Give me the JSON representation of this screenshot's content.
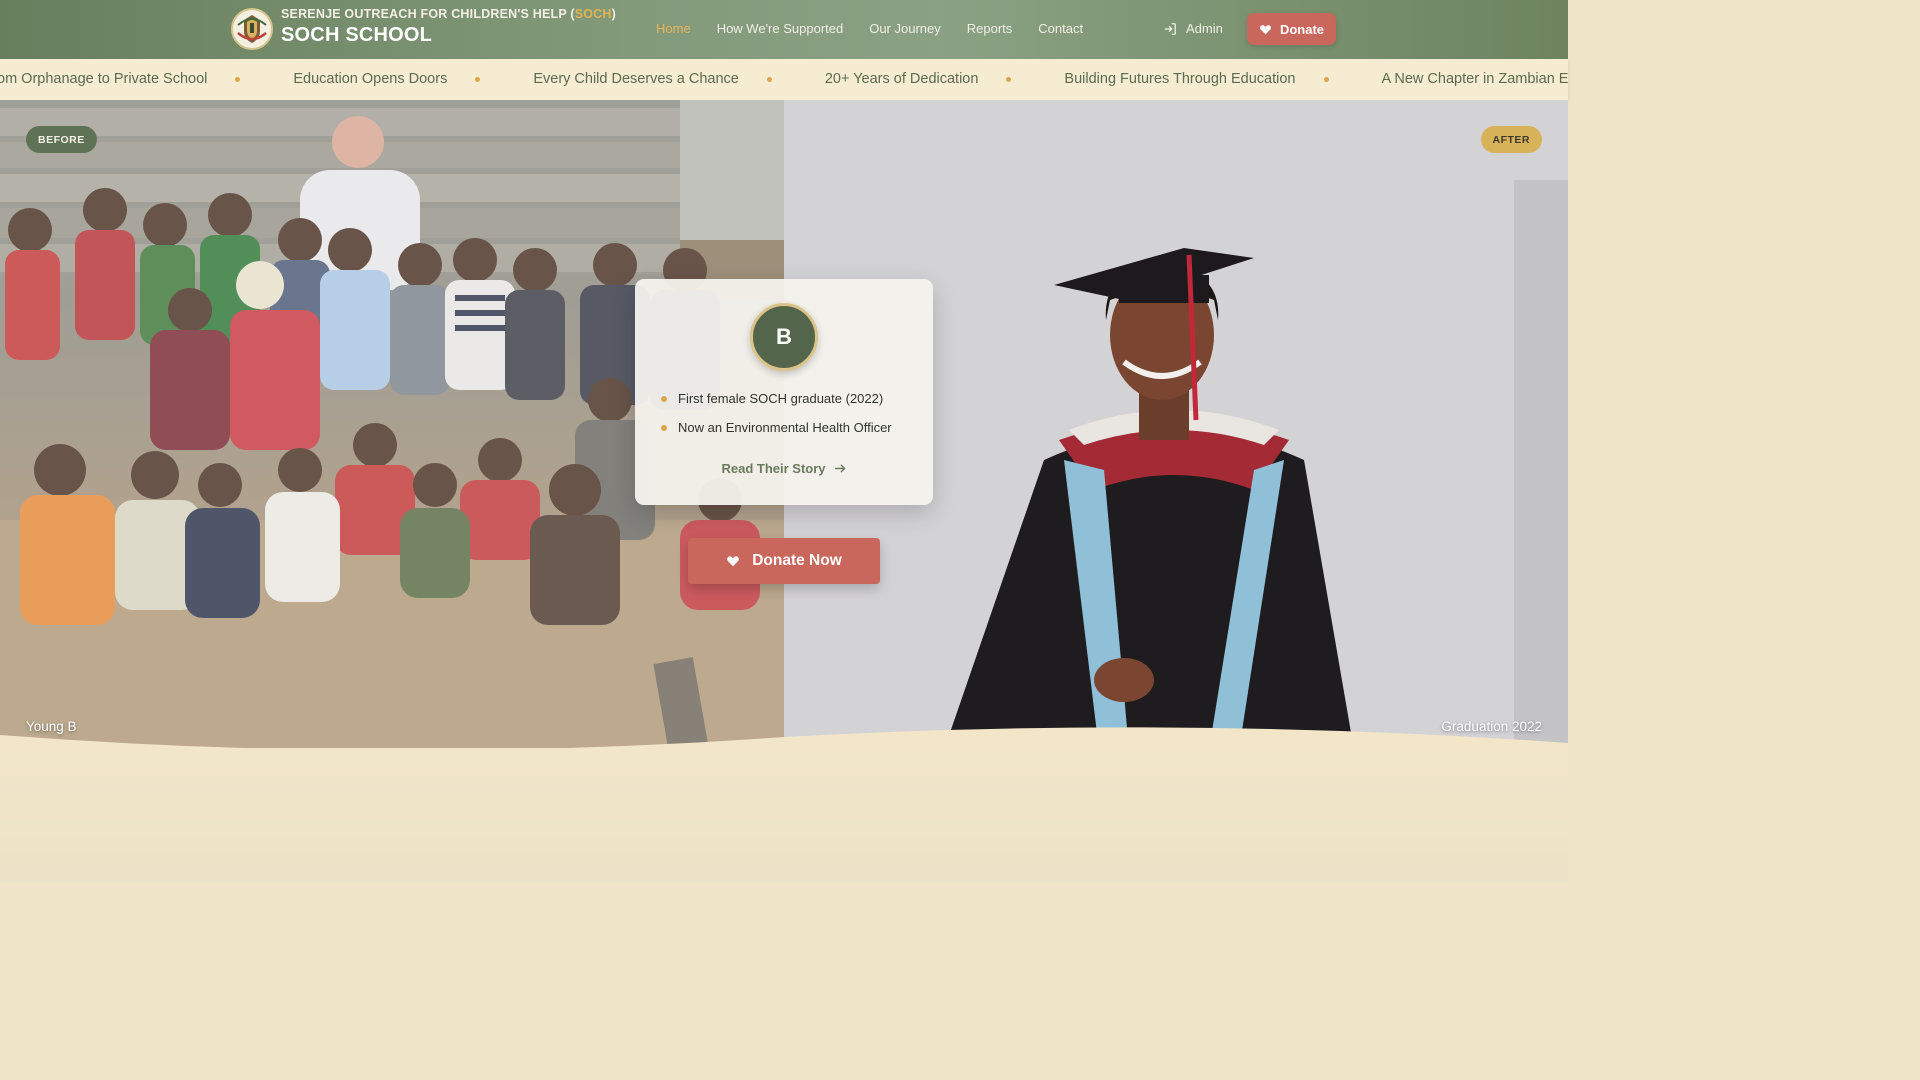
{
  "header": {
    "org_prefix": "SERENJE OUTREACH FOR CHILDREN'S HELP (",
    "org_accent": "SOCH",
    "org_suffix": ")",
    "title": "SOCH SCHOOL",
    "nav": [
      {
        "label": "Home",
        "active": true
      },
      {
        "label": "How We're Supported",
        "active": false
      },
      {
        "label": "Our Journey",
        "active": false
      },
      {
        "label": "Reports",
        "active": false
      },
      {
        "label": "Contact",
        "active": false
      }
    ],
    "admin_label": "Admin",
    "donate_label": "Donate"
  },
  "ticker": {
    "items": [
      "om Orphanage to Private School",
      "Education Opens Doors",
      "Every Child Deserves a Chance",
      "20+ Years of Dedication",
      "Building Futures Through Education",
      "A New Chapter in Zambian Educatio"
    ]
  },
  "hero": {
    "before_badge": "BEFORE",
    "after_badge": "AFTER",
    "before_caption": "Young B",
    "after_caption": "Graduation 2022",
    "card": {
      "initial": "B",
      "facts": [
        "First female SOCH graduate (2022)",
        "Now an Environmental Health Officer"
      ],
      "link_label": "Read Their Story"
    },
    "donate_now_label": "Donate Now"
  },
  "colors": {
    "header_green": "#7b9270",
    "accent_gold": "#d9a64b",
    "donate_red": "#c9675c",
    "cream": "#f3e6c8"
  }
}
